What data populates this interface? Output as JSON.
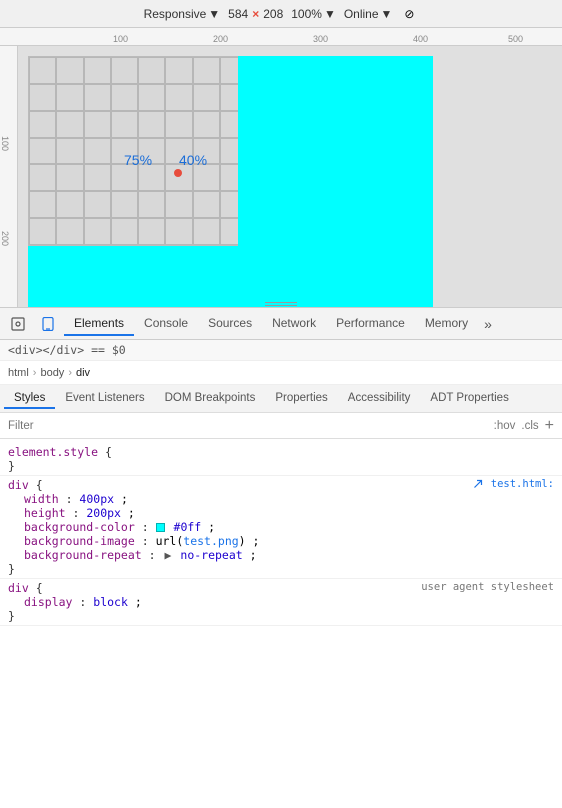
{
  "toolbar": {
    "responsive_label": "Responsive",
    "width_value": "584",
    "height_value": "208",
    "x_sep": "×",
    "zoom_label": "100%",
    "online_label": "Online",
    "throttle_icon": "⊘"
  },
  "rulers": {
    "top_marks": [
      "100",
      "200",
      "300",
      "400",
      "500"
    ],
    "left_marks": [
      "100",
      "200"
    ]
  },
  "viewport": {
    "grid_label_75": "75%",
    "grid_label_40": "40%"
  },
  "devtools": {
    "tabs": [
      {
        "label": "Elements",
        "active": true
      },
      {
        "label": "Console",
        "active": false
      },
      {
        "label": "Sources",
        "active": false
      },
      {
        "label": "Network",
        "active": false
      },
      {
        "label": "Performance",
        "active": false
      },
      {
        "label": "Memory",
        "active": false
      }
    ],
    "more_label": "»"
  },
  "breadcrumb": {
    "items": [
      "html",
      "body",
      "div"
    ]
  },
  "style_tabs": [
    {
      "label": "Styles",
      "active": true
    },
    {
      "label": "Event Listeners",
      "active": false
    },
    {
      "label": "DOM Breakpoints",
      "active": false
    },
    {
      "label": "Properties",
      "active": false
    },
    {
      "label": "Accessibility",
      "active": false
    },
    {
      "label": "ADT Properties",
      "active": false
    }
  ],
  "filter": {
    "placeholder": "Filter",
    "hov_label": ":hov",
    "cls_label": ".cls",
    "add_label": "+"
  },
  "css_rules": [
    {
      "selector": "element.style {",
      "close": "}",
      "properties": []
    },
    {
      "selector": "div {",
      "close": "}",
      "source": "test.html:",
      "properties": [
        {
          "prop": "width",
          "value": "400px",
          "type": "px"
        },
        {
          "prop": "height",
          "value": "200px",
          "type": "px"
        },
        {
          "prop": "background-color",
          "value": "#0ff",
          "type": "color",
          "swatch": "#00ffff"
        },
        {
          "prop": "background-image",
          "value": "url(test.png)",
          "type": "url",
          "link_text": "test.png"
        },
        {
          "prop": "background-repeat",
          "value": "no-repeat",
          "type": "keyword",
          "arrow": "▶"
        }
      ]
    },
    {
      "selector": "div {",
      "close": "}",
      "source_label": "user agent stylesheet",
      "properties": [
        {
          "prop": "display",
          "value": "block",
          "type": "keyword"
        }
      ]
    }
  ]
}
